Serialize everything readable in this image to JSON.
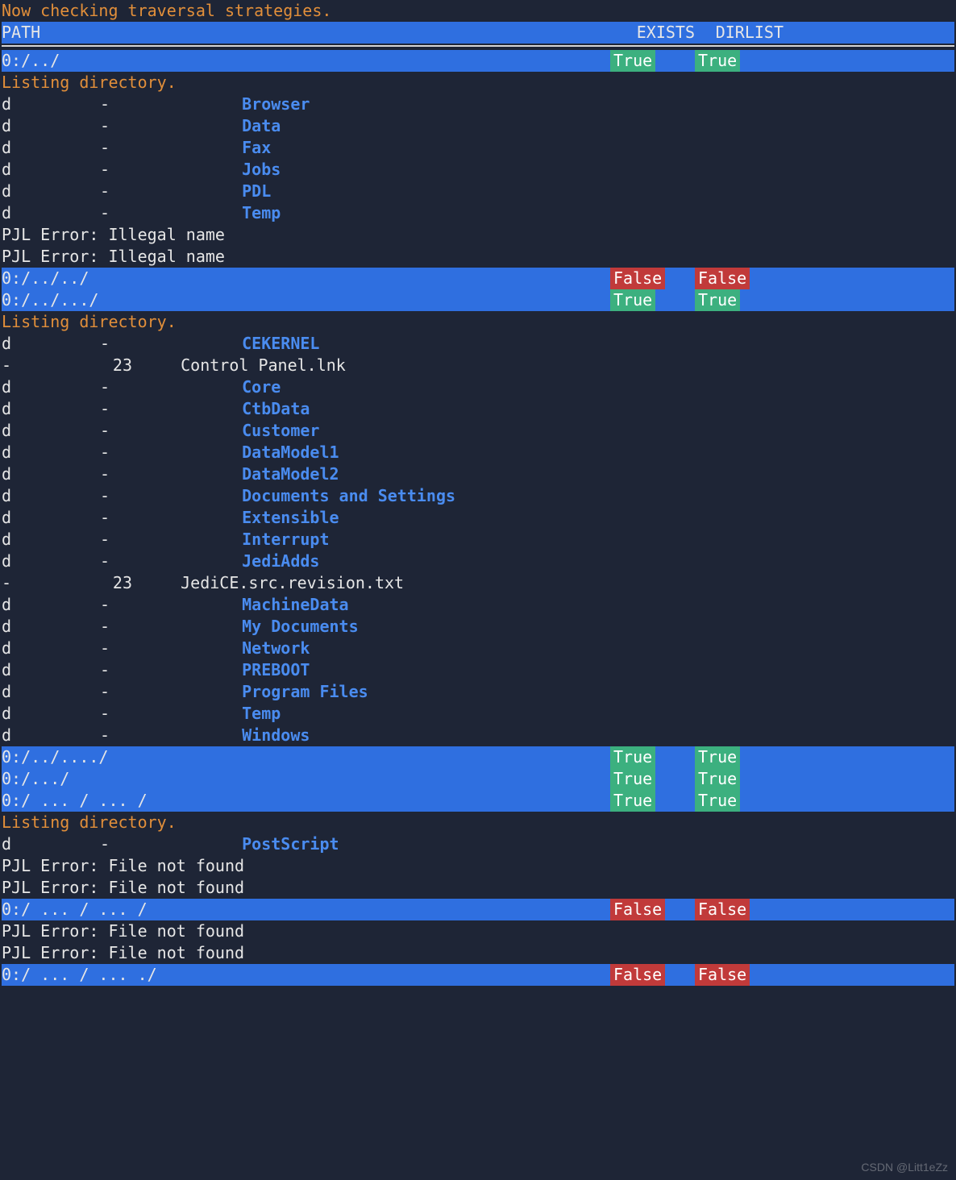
{
  "top_status": "Now checking traversal strategies.",
  "header": {
    "path": "PATH",
    "exists": "EXISTS",
    "dirlist": "DIRLIST"
  },
  "sections": [
    {
      "type": "pathrow",
      "path": "0:/../",
      "exists": "True",
      "dirlist": "True"
    },
    {
      "type": "listing_hdr",
      "text": "Listing directory."
    },
    {
      "type": "listing",
      "items": [
        {
          "t": "d",
          "s": "-",
          "n": "Browser",
          "dir": true
        },
        {
          "t": "d",
          "s": "-",
          "n": "Data",
          "dir": true
        },
        {
          "t": "d",
          "s": "-",
          "n": "Fax",
          "dir": true
        },
        {
          "t": "d",
          "s": "-",
          "n": "Jobs",
          "dir": true
        },
        {
          "t": "d",
          "s": "-",
          "n": "PDL",
          "dir": true
        },
        {
          "t": "d",
          "s": "-",
          "n": "Temp",
          "dir": true
        }
      ]
    },
    {
      "type": "error",
      "text": "PJL Error: Illegal name"
    },
    {
      "type": "error",
      "text": "PJL Error: Illegal name"
    },
    {
      "type": "pathrow",
      "path": "0:/../../",
      "exists": "False",
      "dirlist": "False"
    },
    {
      "type": "pathrow",
      "path": "0:/../.../",
      "exists": "True",
      "dirlist": "True"
    },
    {
      "type": "listing_hdr",
      "text": "Listing directory."
    },
    {
      "type": "listing",
      "items": [
        {
          "t": "d",
          "s": "-",
          "n": "CEKERNEL",
          "dir": true
        },
        {
          "t": "-",
          "s": "23",
          "n": "Control Panel.lnk",
          "dir": false
        },
        {
          "t": "d",
          "s": "-",
          "n": "Core",
          "dir": true
        },
        {
          "t": "d",
          "s": "-",
          "n": "CtbData",
          "dir": true
        },
        {
          "t": "d",
          "s": "-",
          "n": "Customer",
          "dir": true
        },
        {
          "t": "d",
          "s": "-",
          "n": "DataModel1",
          "dir": true
        },
        {
          "t": "d",
          "s": "-",
          "n": "DataModel2",
          "dir": true
        },
        {
          "t": "d",
          "s": "-",
          "n": "Documents and Settings",
          "dir": true
        },
        {
          "t": "d",
          "s": "-",
          "n": "Extensible",
          "dir": true
        },
        {
          "t": "d",
          "s": "-",
          "n": "Interrupt",
          "dir": true
        },
        {
          "t": "d",
          "s": "-",
          "n": "JediAdds",
          "dir": true
        },
        {
          "t": "-",
          "s": "23",
          "n": "JediCE.src.revision.txt",
          "dir": false
        },
        {
          "t": "d",
          "s": "-",
          "n": "MachineData",
          "dir": true
        },
        {
          "t": "d",
          "s": "-",
          "n": "My Documents",
          "dir": true
        },
        {
          "t": "d",
          "s": "-",
          "n": "Network",
          "dir": true
        },
        {
          "t": "d",
          "s": "-",
          "n": "PREBOOT",
          "dir": true
        },
        {
          "t": "d",
          "s": "-",
          "n": "Program Files",
          "dir": true
        },
        {
          "t": "d",
          "s": "-",
          "n": "Temp",
          "dir": true
        },
        {
          "t": "d",
          "s": "-",
          "n": "Windows",
          "dir": true
        }
      ]
    },
    {
      "type": "pathrow",
      "path": "0:/../..../",
      "exists": "True",
      "dirlist": "True"
    },
    {
      "type": "pathrow",
      "path": "0:/.../",
      "exists": "True",
      "dirlist": "True"
    },
    {
      "type": "pathrow",
      "path": "0:/ ... / ... /",
      "exists": "True",
      "dirlist": "True"
    },
    {
      "type": "listing_hdr",
      "text": "Listing directory."
    },
    {
      "type": "listing",
      "items": [
        {
          "t": "d",
          "s": "-",
          "n": "PostScript",
          "dir": true
        }
      ]
    },
    {
      "type": "error",
      "text": "PJL Error: File not found"
    },
    {
      "type": "error",
      "text": "PJL Error: File not found"
    },
    {
      "type": "pathrow",
      "path": "0:/ ... / ... /",
      "exists": "False",
      "dirlist": "False"
    },
    {
      "type": "error",
      "text": "PJL Error: File not found"
    },
    {
      "type": "error",
      "text": "PJL Error: File not found"
    },
    {
      "type": "pathrow",
      "path": "0:/ ... / ... ./",
      "exists": "False",
      "dirlist": "False"
    }
  ],
  "watermark": "CSDN @Litt1eZz"
}
